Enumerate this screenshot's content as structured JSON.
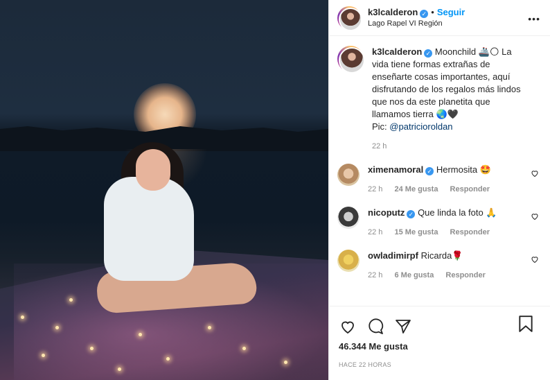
{
  "post": {
    "username": "k3lcalderon",
    "follow_label": "Seguir",
    "location": "Lago Rapel VI Región",
    "more_label": "•••"
  },
  "caption": {
    "username": "k3lcalderon",
    "title": "Moonchild 🚢🌕",
    "body": "La vida tiene formas extrañas de enseñarte cosas importantes, aquí disfrutando de los regalos más lindos que nos da este planetita que llamamos tierra 🌏🖤",
    "credit_prefix": "Pic: ",
    "credit_handle": "@patricioroldan",
    "time": "22 h"
  },
  "comments": [
    {
      "username": "ximenamoral",
      "verified": true,
      "text": "Hermosita 🤩",
      "time": "22 h",
      "likes": "24 Me gusta",
      "reply": "Responder"
    },
    {
      "username": "nicoputz",
      "verified": true,
      "text": "Que linda la foto 🙏",
      "time": "22 h",
      "likes": "15 Me gusta",
      "reply": "Responder"
    },
    {
      "username": "owladimirpf",
      "verified": false,
      "text": "Ricarda🌹",
      "time": "22 h",
      "likes": "6 Me gusta",
      "reply": "Responder"
    }
  ],
  "stats": {
    "likes": "46.344 Me gusta",
    "posted": "HACE 22 HORAS"
  },
  "icons": {
    "like": "heart-icon",
    "comment": "comment-icon",
    "share": "share-icon",
    "save": "bookmark-icon",
    "verified": "verified-icon"
  }
}
